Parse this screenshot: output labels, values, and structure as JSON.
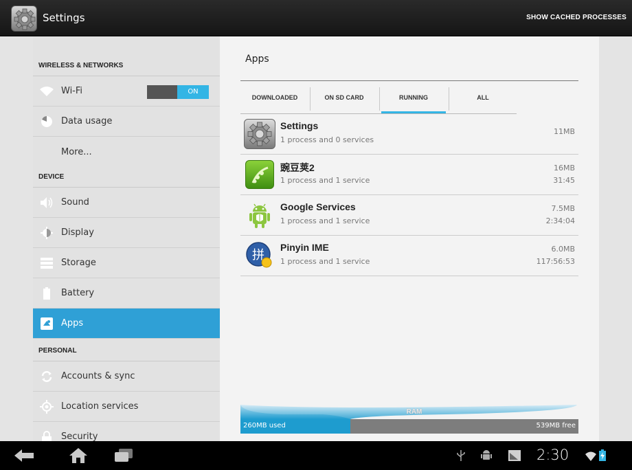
{
  "action_bar": {
    "title": "Settings",
    "cached_button": "SHOW CACHED PROCESSES"
  },
  "sidebar": {
    "sections": [
      {
        "label": "WIRELESS & NETWORKS"
      },
      {
        "label": "DEVICE"
      },
      {
        "label": "PERSONAL"
      }
    ],
    "items": [
      {
        "label": "Wi-Fi",
        "icon": "wifi-icon"
      },
      {
        "label": "Data usage",
        "icon": "data-usage-icon"
      },
      {
        "label": "More..."
      },
      {
        "label": "Sound",
        "icon": "sound-icon"
      },
      {
        "label": "Display",
        "icon": "display-icon"
      },
      {
        "label": "Storage",
        "icon": "storage-icon"
      },
      {
        "label": "Battery",
        "icon": "battery-icon"
      },
      {
        "label": "Apps",
        "icon": "apps-icon",
        "selected": true
      },
      {
        "label": "Accounts & sync",
        "icon": "sync-icon"
      },
      {
        "label": "Location services",
        "icon": "location-icon"
      },
      {
        "label": "Security",
        "icon": "lock-icon"
      }
    ],
    "wifi_toggle": "ON"
  },
  "apps": {
    "title": "Apps",
    "tabs": [
      {
        "label": "DOWNLOADED"
      },
      {
        "label": "ON SD CARD"
      },
      {
        "label": "RUNNING",
        "active": true
      },
      {
        "label": "ALL"
      }
    ],
    "list": [
      {
        "name": "Settings",
        "sub": "1 process and 0 services",
        "size": "11MB",
        "time": ""
      },
      {
        "name": "豌豆荚2",
        "sub": "1 process and 1 service",
        "size": "16MB",
        "time": "31:45"
      },
      {
        "name": "Google Services",
        "sub": "1 process and 1 service",
        "size": "7.5MB",
        "time": "2:34:04"
      },
      {
        "name": "Pinyin IME",
        "sub": "1 process and 1 service",
        "size": "6.0MB",
        "time": "117:56:53"
      }
    ],
    "ram": {
      "label": "RAM",
      "used": "260MB used",
      "free": "539MB free",
      "used_fraction": 0.325
    }
  },
  "system_bar": {
    "clock": "2:30"
  },
  "colors": {
    "accent": "#33b5e5",
    "selected_item": "#2fa0d6"
  }
}
